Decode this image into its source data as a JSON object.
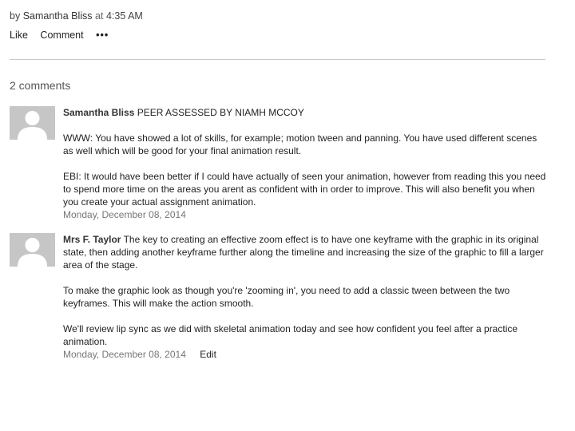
{
  "post": {
    "byline_prefix": "by",
    "author": "Samantha Bliss",
    "at": "at",
    "time": "4:35 AM"
  },
  "actions": {
    "like": "Like",
    "comment": "Comment",
    "more": "•••"
  },
  "comments_header": "2 comments",
  "comments": [
    {
      "author": "Samantha Bliss",
      "first_line": " PEER ASSESSED BY NIAMH MCCOY",
      "paragraphs": [
        "WWW: You have showed a lot of skills, for example; motion tween and panning. You have used different scenes as well which will be good for your final animation result.",
        "EBI: It would have been better if I could have actually of seen your animation, however from reading this you need to spend more time on the areas you arent as confident with in order to improve. This will also benefit you when you create your actual assignment animation."
      ],
      "date": "Monday, December 08, 2014"
    },
    {
      "author": "Mrs F. Taylor",
      "first_line": " The key to creating an effective zoom effect is to have one keyframe with the graphic in its original state, then adding another keyframe further along the timeline and increasing the size of the graphic to fill a larger area of the stage.",
      "paragraphs": [
        "To make the graphic look as though you're 'zooming in', you need to add a classic tween between the two keyframes. This will make the action smooth.",
        "We'll review lip sync as we did with skeletal animation today and see how confident you feel after a practice animation."
      ],
      "date": "Monday, December 08, 2014",
      "edit": "Edit"
    }
  ]
}
